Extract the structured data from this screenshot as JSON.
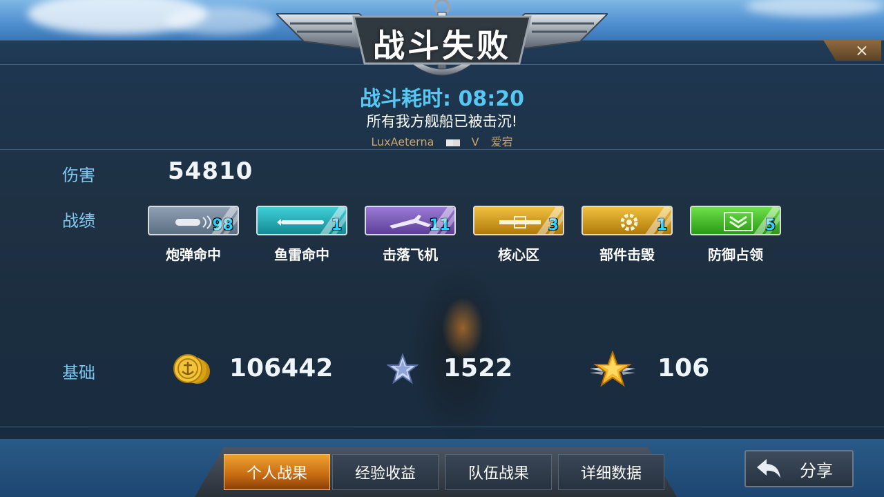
{
  "header": {
    "title": "战斗失败",
    "close_symbol": "×"
  },
  "battle": {
    "time_label": "战斗耗时: ",
    "time_value": "08:20",
    "message": "所有我方舰船已被击沉!",
    "player": "LuxAeterna",
    "vs": "V",
    "opponent": "爱宕"
  },
  "damage": {
    "label": "伤害",
    "value": "54810"
  },
  "record": {
    "label": "战绩",
    "items": [
      {
        "name": "炮弹命中",
        "count": "98",
        "color": "#6c7e93",
        "icon": "shell-icon"
      },
      {
        "name": "鱼雷命中",
        "count": "1",
        "color": "#1aa9b4",
        "icon": "torpedo-icon"
      },
      {
        "name": "击落飞机",
        "count": "11",
        "color": "#7a56b8",
        "icon": "plane-icon"
      },
      {
        "name": "核心区",
        "count": "3",
        "color": "#d49a12",
        "icon": "core-icon"
      },
      {
        "name": "部件击毁",
        "count": "1",
        "color": "#d49a12",
        "icon": "gear-icon"
      },
      {
        "name": "防御占领",
        "count": "5",
        "color": "#3fc22a",
        "icon": "chevron-icon"
      }
    ]
  },
  "base": {
    "label": "基础",
    "coins": "106442",
    "exp": "1522",
    "rank": "106"
  },
  "tabs": [
    {
      "label": "个人战果",
      "active": true
    },
    {
      "label": "经验收益",
      "active": false
    },
    {
      "label": "队伍战果",
      "active": false
    },
    {
      "label": "详细数据",
      "active": false
    }
  ],
  "share": {
    "label": "分享"
  }
}
